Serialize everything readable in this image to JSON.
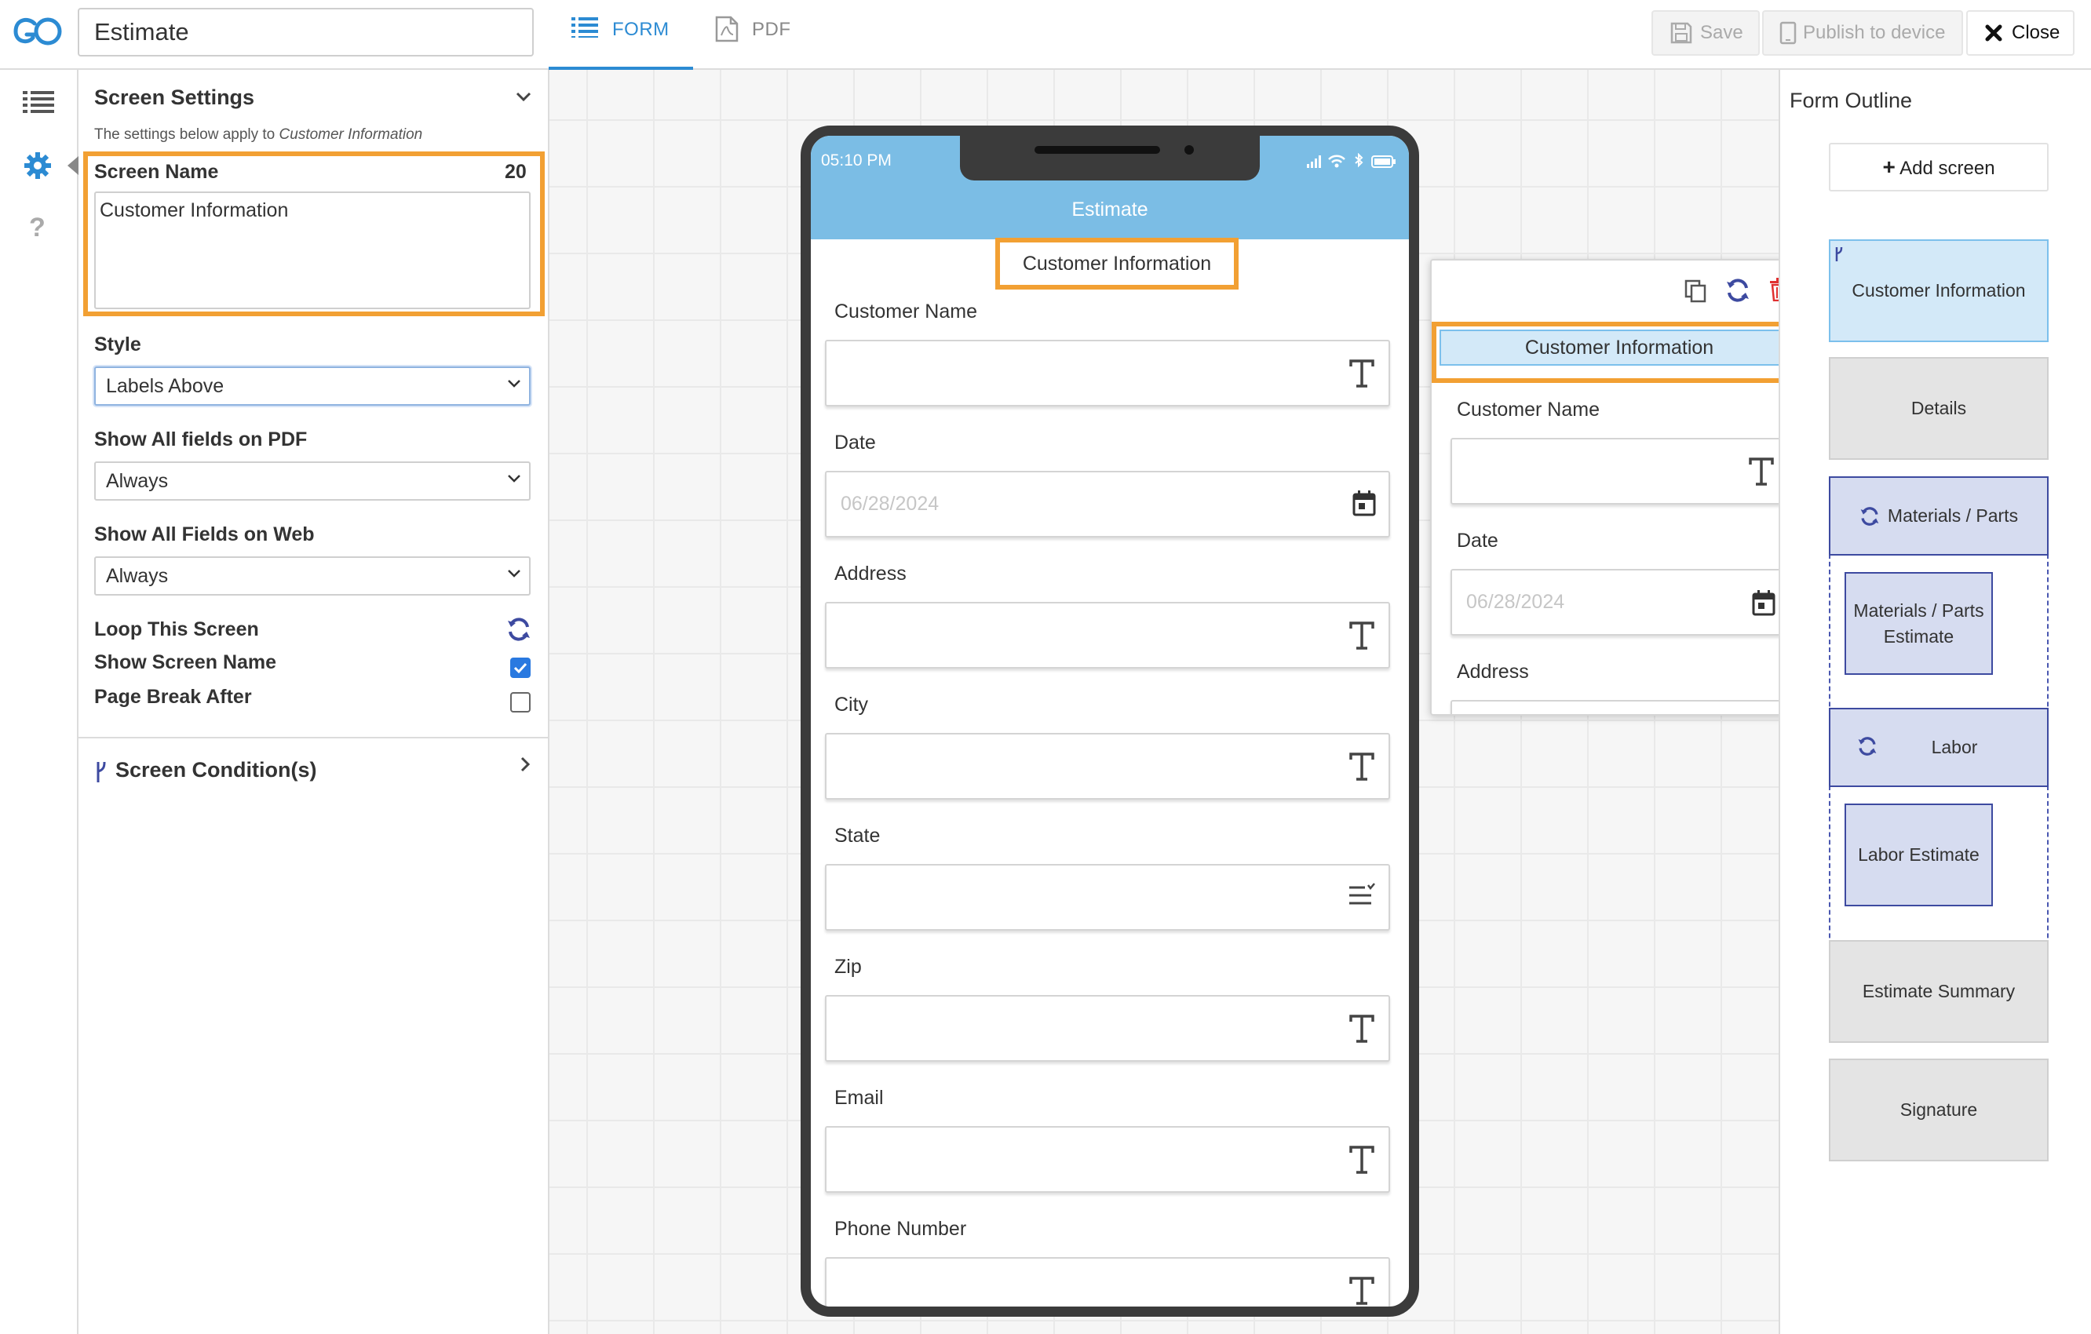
{
  "header": {
    "form_title": "Estimate",
    "tabs": [
      {
        "label": "FORM",
        "active": true
      },
      {
        "label": "PDF",
        "active": false
      }
    ],
    "save_label": "Save",
    "publish_label": "Publish to device",
    "close_label": "Close"
  },
  "settings": {
    "title": "Screen Settings",
    "subtitle_prefix": "The settings below apply to ",
    "subtitle_screen": "Customer Information",
    "screen_name_label": "Screen Name",
    "screen_name_count": "20",
    "screen_name_value": "Customer Information",
    "style_label": "Style",
    "style_value": "Labels Above",
    "pdf_label": "Show All fields on PDF",
    "pdf_value": "Always",
    "web_label": "Show All Fields on Web",
    "web_value": "Always",
    "loop_label": "Loop This Screen",
    "show_name_label": "Show Screen Name",
    "show_name_checked": true,
    "page_break_label": "Page Break After",
    "page_break_checked": false,
    "conditions_label": "Screen Condition(s)"
  },
  "phone": {
    "time": "05:10 PM",
    "app_title": "Estimate",
    "screen_name": "Customer Information",
    "fields": [
      {
        "label": "Customer Name",
        "placeholder": "",
        "icon": "text-icon"
      },
      {
        "label": "Date",
        "placeholder": "06/28/2024",
        "icon": "calendar-icon"
      },
      {
        "label": "Address",
        "placeholder": "",
        "icon": "text-icon"
      },
      {
        "label": "City",
        "placeholder": "",
        "icon": "text-icon"
      },
      {
        "label": "State",
        "placeholder": "",
        "icon": "list-icon"
      },
      {
        "label": "Zip",
        "placeholder": "",
        "icon": "text-icon"
      },
      {
        "label": "Email",
        "placeholder": "",
        "icon": "text-icon"
      },
      {
        "label": "Phone Number",
        "placeholder": "",
        "icon": "text-icon"
      }
    ]
  },
  "preview": {
    "screen_name": "Customer Information",
    "fields": [
      {
        "label": "Customer Name",
        "placeholder": ""
      },
      {
        "label": "Date",
        "placeholder": "06/28/2024"
      },
      {
        "label": "Address",
        "placeholder": ""
      }
    ]
  },
  "outline": {
    "title": "Form Outline",
    "add_screen_label": "Add screen",
    "screens": [
      {
        "name": "Customer Information",
        "selected": true,
        "has_condition": true
      },
      {
        "name": "Details"
      },
      {
        "name": "Materials / Parts",
        "loop": true,
        "children": [
          "Materials / Parts Estimate"
        ]
      },
      {
        "name": "Labor",
        "loop": true,
        "children": [
          "Labor Estimate"
        ]
      },
      {
        "name": "Estimate Summary"
      },
      {
        "name": "Signature"
      }
    ]
  },
  "colors": {
    "accent": "#2c8bd3",
    "highlight": "#f2a033",
    "phone_header": "#7bbde5",
    "loop_blue": "#3d4aa0",
    "delete_red": "#e03030"
  }
}
